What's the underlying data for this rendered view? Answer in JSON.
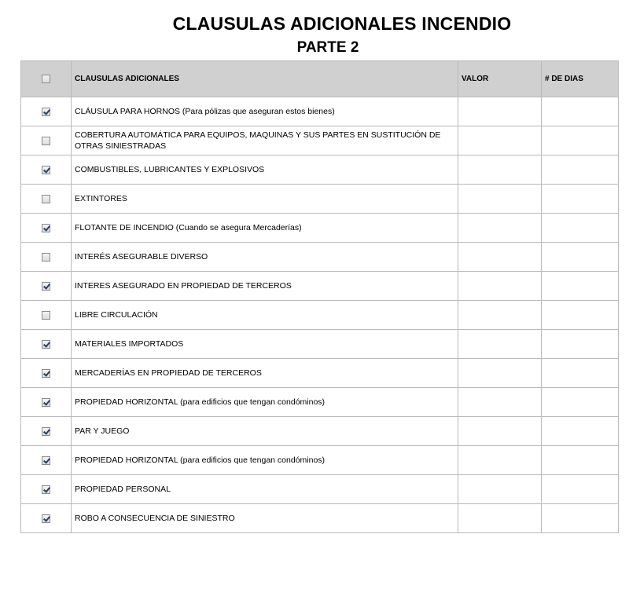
{
  "title": "CLAUSULAS ADICIONALES INCENDIO",
  "subtitle": "PARTE 2",
  "table": {
    "headers": {
      "clausulas": "CLAUSULAS ADICIONALES",
      "valor": "VALOR",
      "dias": "# DE DIAS"
    },
    "header_checkbox_checked": false,
    "rows": [
      {
        "label": "CLÁUSULA PARA HORNOS (Para pólizas que aseguran estos bienes)",
        "checked": true,
        "valor": "",
        "dias": ""
      },
      {
        "label": "COBERTURA AUTOMÁTICA PARA EQUIPOS, MAQUINAS Y SUS PARTES EN SUSTITUCIÓN DE OTRAS SINIESTRADAS",
        "checked": false,
        "valor": "",
        "dias": ""
      },
      {
        "label": "COMBUSTIBLES, LUBRICANTES Y EXPLOSIVOS",
        "checked": true,
        "valor": "",
        "dias": ""
      },
      {
        "label": "EXTINTORES",
        "checked": false,
        "valor": "",
        "dias": ""
      },
      {
        "label": "FLOTANTE DE INCENDIO (Cuando se asegura Mercaderías)",
        "checked": true,
        "valor": "",
        "dias": ""
      },
      {
        "label": "INTERÉS ASEGURABLE DIVERSO",
        "checked": false,
        "valor": "",
        "dias": ""
      },
      {
        "label": "INTERES ASEGURADO EN PROPIEDAD DE TERCEROS",
        "checked": true,
        "valor": "",
        "dias": ""
      },
      {
        "label": "LIBRE CIRCULACIÓN",
        "checked": false,
        "valor": "",
        "dias": ""
      },
      {
        "label": "MATERIALES IMPORTADOS",
        "checked": true,
        "valor": "",
        "dias": ""
      },
      {
        "label": "MERCADERÍAS EN PROPIEDAD DE TERCEROS",
        "checked": true,
        "valor": "",
        "dias": ""
      },
      {
        "label": "PROPIEDAD HORIZONTAL (para edificios que tengan condóminos)",
        "checked": true,
        "valor": "",
        "dias": ""
      },
      {
        "label": "PAR Y JUEGO",
        "checked": true,
        "valor": "",
        "dias": ""
      },
      {
        "label": "PROPIEDAD HORIZONTAL (para edificios que tengan condóminos)",
        "checked": true,
        "valor": "",
        "dias": ""
      },
      {
        "label": "PROPIEDAD PERSONAL",
        "checked": true,
        "valor": "",
        "dias": ""
      },
      {
        "label": "ROBO A CONSECUENCIA DE SINIESTRO",
        "checked": true,
        "valor": "",
        "dias": ""
      }
    ]
  }
}
